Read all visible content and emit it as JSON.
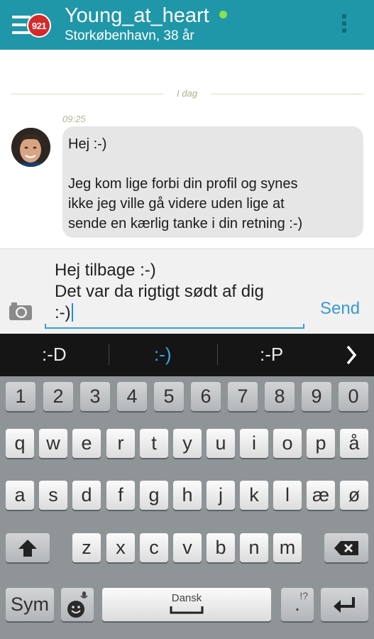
{
  "header": {
    "badge_count": "921",
    "username": "Young_at_heart",
    "location": "Storkøbenhavn, 38 år",
    "online_color": "#8ee04a",
    "bar_color": "#1f97a8"
  },
  "chat": {
    "date_label": "I dag",
    "messages": [
      {
        "time": "09:25",
        "lines": [
          "Hej :-)",
          "",
          "Jeg kom lige forbi din profil og synes",
          "ikke jeg ville gå videre uden lige at",
          "sende en kærlig tanke i din retning :-)"
        ]
      }
    ]
  },
  "composer": {
    "lines": [
      "Hej tilbage :-)",
      "Det var da rigtigt sødt af dig",
      ":-)"
    ],
    "send_label": "Send",
    "accent": "#3a98d4"
  },
  "suggestions": [
    ":-D",
    ":-)",
    ":-P"
  ],
  "keyboard": {
    "row_numbers": [
      "1",
      "2",
      "3",
      "4",
      "5",
      "6",
      "7",
      "8",
      "9",
      "0"
    ],
    "row_1": [
      "q",
      "w",
      "e",
      "r",
      "t",
      "y",
      "u",
      "i",
      "o",
      "p",
      "å"
    ],
    "row_2": [
      "a",
      "s",
      "d",
      "f",
      "g",
      "h",
      "j",
      "k",
      "l",
      "æ",
      "ø"
    ],
    "row_3": [
      "z",
      "x",
      "c",
      "v",
      "b",
      "n",
      "m"
    ],
    "sym_label": "Sym",
    "space_label": "Dansk",
    "period_label": ".",
    "period_sub": "!?"
  }
}
